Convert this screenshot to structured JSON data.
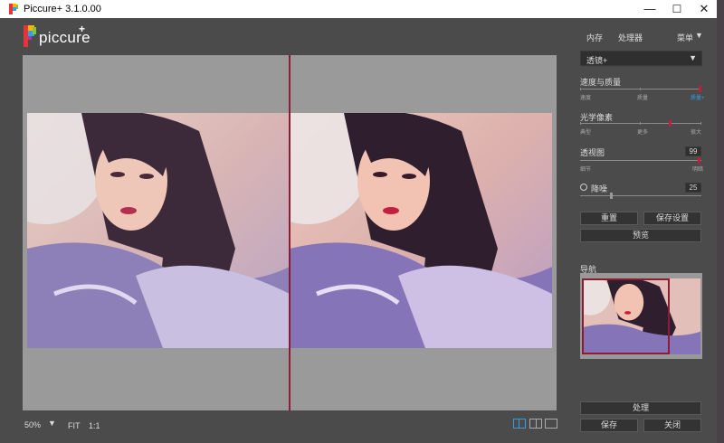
{
  "window": {
    "title": "Piccure+ 3.1.0.00",
    "minimize": "—",
    "maximize": "☐",
    "close": "✕"
  },
  "logo": {
    "text": "piccure",
    "plus": "+"
  },
  "top_menu": {
    "memory": "内存",
    "processor": "处理器",
    "menu": "菜单",
    "menu_caret": "▼"
  },
  "filter": {
    "selected": "透镜+",
    "caret": "▼"
  },
  "speed_quality": {
    "label": "速度与质量",
    "left": "速度",
    "mid": "质量",
    "right": "质量+",
    "level": 1.0
  },
  "optical_pixel": {
    "label": "光学像素",
    "left": "典型",
    "mid": "更多",
    "right": "很大",
    "level": 0.75
  },
  "lens_map": {
    "label": "透视图",
    "value": "99",
    "left": "细节",
    "right": "明暗",
    "level": 0.99
  },
  "denoise": {
    "label": "降噪",
    "value": "25",
    "level": 0.25
  },
  "buttons": {
    "reset": "重置",
    "save_settings": "保存设置",
    "preview": "预览",
    "process": "处理",
    "save": "保存",
    "close": "关闭"
  },
  "navigator": {
    "label": "导航"
  },
  "statusbar": {
    "zoom": "50%",
    "zoom_caret": "▼",
    "fit": "FIT",
    "one_to_one": "1:1"
  },
  "colors": {
    "accent": "#c41d3a",
    "panel": "#4b4b4b",
    "canvas": "#9a9a9a"
  }
}
